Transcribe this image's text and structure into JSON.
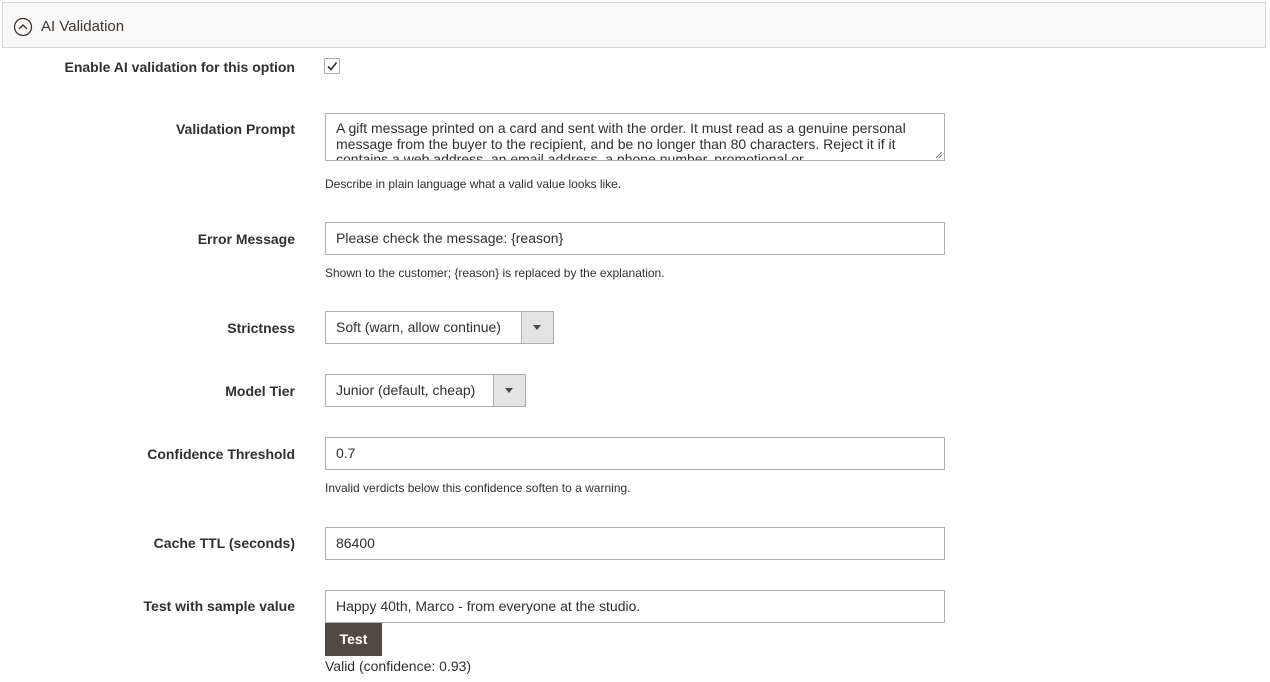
{
  "section": {
    "title": "AI Validation",
    "icon": "chevron-up-circle-icon"
  },
  "enable": {
    "label": "Enable AI validation for this option",
    "checked": true
  },
  "prompt": {
    "label": "Validation Prompt",
    "value": "A gift message printed on a card and sent with the order. It must read as a genuine personal message from the buyer to the recipient, and be no longer than 80 characters. Reject it if it contains a web address, an email address, a phone number, promotional or",
    "note": "Describe in plain language what a valid value looks like."
  },
  "error_message": {
    "label": "Error Message",
    "value": "Please check the message: {reason}",
    "note": "Shown to the customer; {reason} is replaced by the explanation."
  },
  "strictness": {
    "label": "Strictness",
    "selected": "Soft (warn, allow continue)"
  },
  "model_tier": {
    "label": "Model Tier",
    "selected": "Junior (default, cheap)"
  },
  "confidence": {
    "label": "Confidence Threshold",
    "value": "0.7",
    "note": "Invalid verdicts below this confidence soften to a warning."
  },
  "cache_ttl": {
    "label": "Cache TTL (seconds)",
    "value": "86400"
  },
  "test": {
    "label": "Test with sample value",
    "value": "Happy 40th, Marco - from everyone at the studio.",
    "button_label": "Test",
    "result": "Valid (confidence: 0.93)"
  },
  "colors": {
    "button_bg": "#514943",
    "header_bg": "#f8f8f8",
    "border": "#adadad"
  }
}
